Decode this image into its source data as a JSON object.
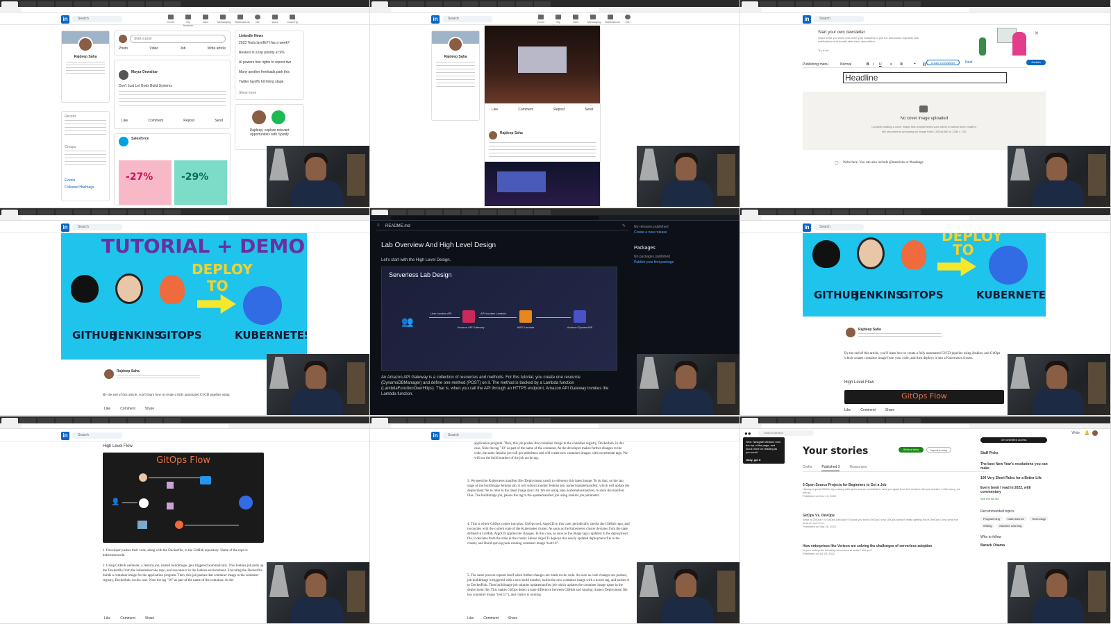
{
  "shared": {
    "search_placeholder": "Search",
    "nav_items": [
      "Home",
      "My Network",
      "Jobs",
      "Messaging",
      "Notifications",
      "Me",
      "Work",
      "Learning"
    ]
  },
  "panel1": {
    "profile_name": "Rajdeep Saha",
    "share_prompt": "Start a post",
    "share_actions": [
      "Photo",
      "Video",
      "Job",
      "Write article"
    ],
    "post_author": "Mayur Dewaikar",
    "post_headline": "Don't Just Let Gods Build Systems",
    "post_actions": [
      "Like",
      "Comment",
      "Repost",
      "Send"
    ],
    "promo_author": "Salesforce",
    "promo_stat_1": "-27%",
    "promo_stat_2": "-29%",
    "news_title": "LinkedIn News",
    "news_items": [
      "2023 Tesla layoffs? Has a week?",
      "Reuters is a top priority at 9%",
      "AI powers first rights to repost two",
      "Many another freeloads park this",
      "Twitter layoffs hit hiring stage"
    ],
    "show_more": "Show more",
    "ad_text": "Rajdeep, explore relevant opportunities with Spotify",
    "sidebar_sections": [
      "Recent",
      "Groups",
      "Events",
      "Followed Hashtags"
    ]
  },
  "panel2": {
    "profile_name": "Rajdeep Saha",
    "post_author": "Rajdeep Saha",
    "post_actions": [
      "Like",
      "Comment",
      "Repost",
      "Send"
    ]
  },
  "panel3": {
    "newsletter_title": "Start your own newsletter",
    "newsletter_sub": "Share what you know and invite your followers to join the discussion regularly with notifications and emails after each new edition.",
    "try_it": "Try it out",
    "publishing_menu": "Publishing menu",
    "style_select": "Normal",
    "create_newsletter": "Create a newsletter",
    "next_label": "Next",
    "publish_label": "Publish",
    "headline_placeholder": "Headline",
    "cover_title": "No cover image uploaded",
    "cover_hint": "Consider adding a cover image that complements your article to attract more readers.",
    "cover_size": "We recommend uploading an image that's 1920x1080 or 1280 x 720.",
    "write_prompt": "Write here. You can also include @mentions or #hashtags."
  },
  "panel4": {
    "banner_line1": "TUTORIAL + DEMO",
    "banner_deploy": "DEPLOY",
    "banner_to": "TO",
    "tools": [
      "GITHUB",
      "JENKINS",
      "GITOPS",
      "KUBERNETES"
    ],
    "author": "Rajdeep Saha",
    "intro": "By the end of this article, you'll learn how to create a fully automated CI/CD pipeline using",
    "actions": [
      "Like",
      "Comment",
      "Share"
    ]
  },
  "panel5": {
    "file_name": "README.md",
    "heading": "Lab Overview And High Level Design",
    "intro": "Let's start with the High Level Design.",
    "diagram_title": "Serverless Lab Design",
    "diagram_nodes": [
      "Amazon API Gateway",
      "AWS Lambda",
      "Amazon DynamoDB"
    ],
    "diagram_edges": [
      "User invokes API",
      "API invokes Lambda"
    ],
    "body": "An Amazon API Gateway is a collection of resources and methods. For this tutorial, you create one resource (DynamoDBManager) and define one method (POST) on it. The method is backed by a Lambda function (LambdaFunctionOverHttps). That is, when you call the API through an HTTPS endpoint, Amazon API Gateway invokes the Lambda function.",
    "side_releases": "No releases published",
    "side_create_release": "Create a new release",
    "side_packages": "Packages",
    "side_packages_none": "No packages published",
    "side_publish_package": "Publish your first package"
  },
  "panel6": {
    "banner_deploy": "DEPLOY",
    "banner_to": "TO",
    "tools": [
      "GITHUB",
      "JENKINS",
      "GITOPS",
      "KUBERNETES"
    ],
    "author": "Rajdeep Saha",
    "intro": "By the end of this article, you'll learn how to create a fully automated CI/CD pipeline using Jenkins, and GitOps which creates container image from your code, and then deploys it into a Kubernetes cluster.",
    "section": "High Level Flow",
    "flow_title": "GitOps Flow",
    "actions": [
      "Like",
      "Comment",
      "Share"
    ]
  },
  "panel7": {
    "section": "High Level Flow",
    "flow_title": "GitOps Flow",
    "step1": "Developer pushes their code, along with the Dockerfile, to the GitHub repository. Name of the repo is kubernetescode.",
    "step2": "Using GitHub webhook, a Jenkins job, named buildimage, gets triggered automatically. This Jenkins job pulls up the Dockerfile from the kubernetescode repo, and executes it in the Jenkins environment. Executing the Dockerfile builds a container image for the application program. Then, this job pushes that container image to the container registry, Dockerhub, in this case. Note the tag \"10\" as part of the name of the container. As the",
    "actions": [
      "Like",
      "Comment",
      "Share"
    ]
  },
  "panel8": {
    "para0": "application program. Then, this job pushes that container image to the container registry, Dockerhub, in this case. Note the tag \"10\" as part of the name of the container. As the developer makes further changes to the code, the same Jenkins job will get submitted, and will create new container images with incremental tags. We will use the build number of the job as the tag.",
    "para3": "We need the Kubernetes manifest file (Deployment.yaml) to reference this latest image. To do that, on the last stage of the buildimage Jenkins job, it will submit another Jenkins job, named updatemanifest, which will update the deployment file to refer to the latest image (test:10). We are using repo, kubernetesmanifest, to store the manifest files. The buildimage job, passes the tag to the updatemanifest job using Jenkins job parameter.",
    "para4": "This is where GitOps comes into play. GitOps tool, ArgoCD in this case, periodically checks the GitHub repo, and reconciles with the current state of the Kubernetes cluster. As soon as the Kubernetes cluster deviates from the state defined in GitHub, ArgoCD applies the changes. In this case, as soon as the image tag is updated in the deployment file, it deviates from the state in the cluster. Hence ArgoCD deploys this newly updated deployment file to the cluster, and Build spin up pods running container image \"test:10\".",
    "para5": "The same process repeats itself when further changes are made to the code. As soon as code changes are pushed, job buildimage is triggered with a new build number, builds the new container image with a newer tag, and pushes it to DockerHub. Then buildimage job submits updatemanifest job which updates the container image name in the deployment file. This makes GitOps detect a state difference between GitHub and running cluster (Deployment file has container image \"test:11\"), and cluster is running",
    "actions": [
      "Like",
      "Comment",
      "Share"
    ]
  },
  "panel9": {
    "search_placeholder": "Search Medium",
    "write_label": "Write",
    "page_title": "Your stories",
    "write_story": "Write a story",
    "import_story": "Import a story",
    "tabs": [
      "Drafts",
      "Published 3",
      "Responses"
    ],
    "stories": [
      {
        "title": "5 Open Source Projects for Beginners to Get a Job",
        "desc": "Having a great GitHub repo along with open source contribution sets you apart from the crowd in the job market. In this story, we will go...",
        "meta": "Published on Dec 12, 2022"
      },
      {
        "title": "GitOps Vs. DevOps",
        "desc": "What is GitOps? Is GitOps DevOps? Should you know GitOps? And GitOps doesn't mean getting rid of DevOps? And what the heck is new? Let...",
        "meta": "Published on Sep 28, 2022"
      },
      {
        "title": "How enterprises like Verizon are solving the challenges of serverless adoption",
        "desc": "Is your enterprise adopting serverless at scale? Not yet?",
        "meta": "Published on Jul 26, 2022"
      }
    ],
    "popup_text": "New: Navigate Medium from the top of the page, and focus more on reading as you scroll.",
    "popup_ok": "Okay, got it",
    "get_access": "Get unlimited access",
    "staff_picks": "Staff Picks",
    "picks": [
      "The best New Year's resolutions you can make",
      "100 Very Short Rules for a Better Life",
      "Every book I read in 2022, with commentary"
    ],
    "see_full_list": "See the full list",
    "recommended": "Recommended topics",
    "topics": [
      "Programming",
      "Data Science",
      "Technology",
      "Writing",
      "Machine Learning"
    ],
    "who_to_follow": "Who to follow",
    "follow_name": "Barack Obama"
  },
  "colors": {
    "linkedin_blue": "#0a66c2",
    "banner_cyan": "#1ec4ec",
    "github_dark": "#0d1117",
    "medium_green": "#1a8917"
  }
}
